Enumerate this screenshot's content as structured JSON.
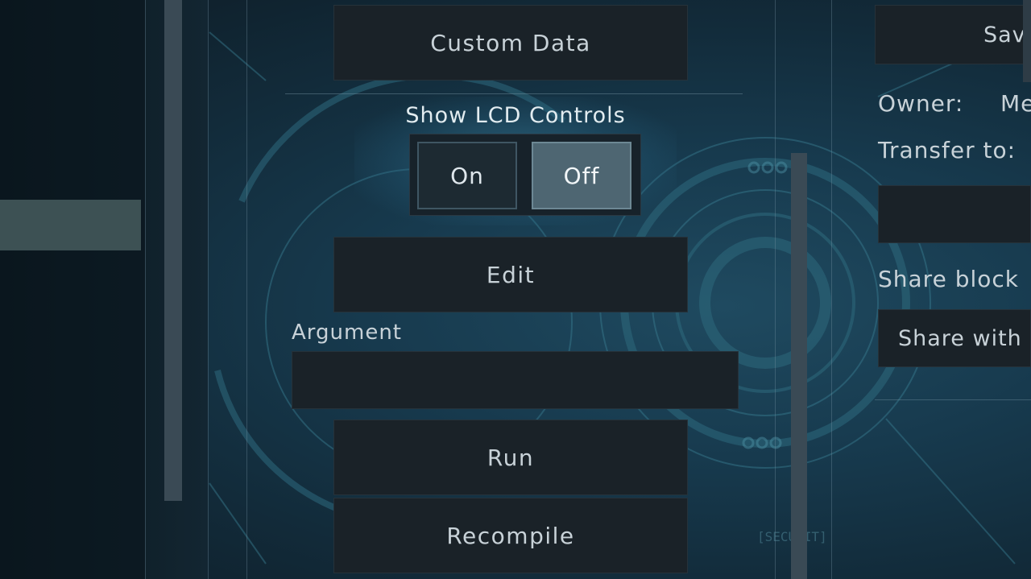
{
  "program_panel": {
    "custom_data_label": "Custom Data",
    "lcd_controls_label": "Show LCD Controls",
    "toggle_on_label": "On",
    "toggle_off_label": "Off",
    "toggle_selected": "Off",
    "edit_label": "Edit",
    "argument_label": "Argument",
    "argument_value": "",
    "run_label": "Run",
    "recompile_label": "Recompile"
  },
  "ownership_panel": {
    "save_label": "Sav",
    "owner_label": "Owner:",
    "owner_value": "Me",
    "transfer_label": "Transfer to:",
    "transfer_value": "",
    "share_block_label": "Share block",
    "share_with_label": "Share with"
  },
  "background_text": "[SECURIT]",
  "colors": {
    "button_bg": "#1a2228",
    "toggle_selected_bg": "#4e6672",
    "text": "#c8d2d8",
    "backdrop": "#173a4e"
  }
}
